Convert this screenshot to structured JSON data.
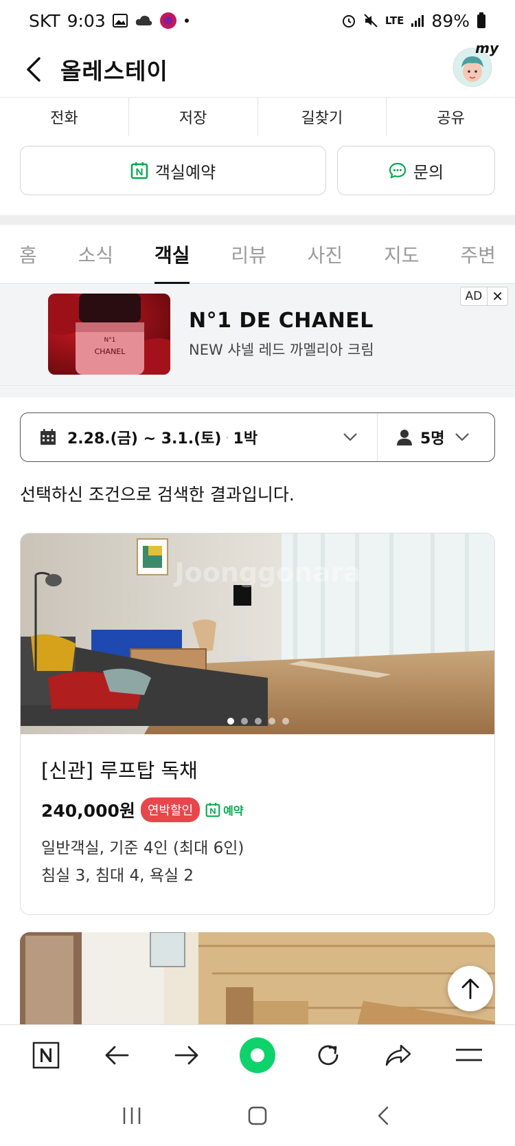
{
  "status_bar": {
    "carrier": "SKT",
    "time": "9:03",
    "battery": "89%",
    "network": "LTE"
  },
  "header": {
    "title": "올레스테이",
    "avatar_label": "my"
  },
  "actions": {
    "call": "전화",
    "save": "저장",
    "directions": "길찾기",
    "share": "공유"
  },
  "buttons": {
    "reserve": "객실예약",
    "inquiry": "문의"
  },
  "tabs": [
    {
      "label": "홈",
      "active": false
    },
    {
      "label": "소식",
      "active": false
    },
    {
      "label": "객실",
      "active": true
    },
    {
      "label": "리뷰",
      "active": false
    },
    {
      "label": "사진",
      "active": false
    },
    {
      "label": "지도",
      "active": false
    },
    {
      "label": "주변",
      "active": false
    }
  ],
  "ad": {
    "title": "N°1 DE CHANEL",
    "subtitle": "NEW 샤넬 레드 까멜리아 크림",
    "badge": "AD",
    "close": "✕",
    "product_brand": "CHANEL",
    "product_top": "N°1"
  },
  "search": {
    "dates": "2.28.(금) ~ 3.1.(토)",
    "dot": "·",
    "nights": "1박",
    "people": "5명"
  },
  "result_text": "선택하신 조건으로 검색한 결과입니다.",
  "room": {
    "name": "[신관] 루프탑 독채",
    "price": "240,000원",
    "discount_badge": "연박할인",
    "booking_label": "예약",
    "info_line1": "일반객실, 기준 4인 (최대 6인)",
    "info_line2": "침실 3, 침대 4, 욕실 2",
    "image_count": 5,
    "current_image": 1
  },
  "colors": {
    "naver_green": "#03a94d",
    "discount_red": "#e8464b"
  }
}
